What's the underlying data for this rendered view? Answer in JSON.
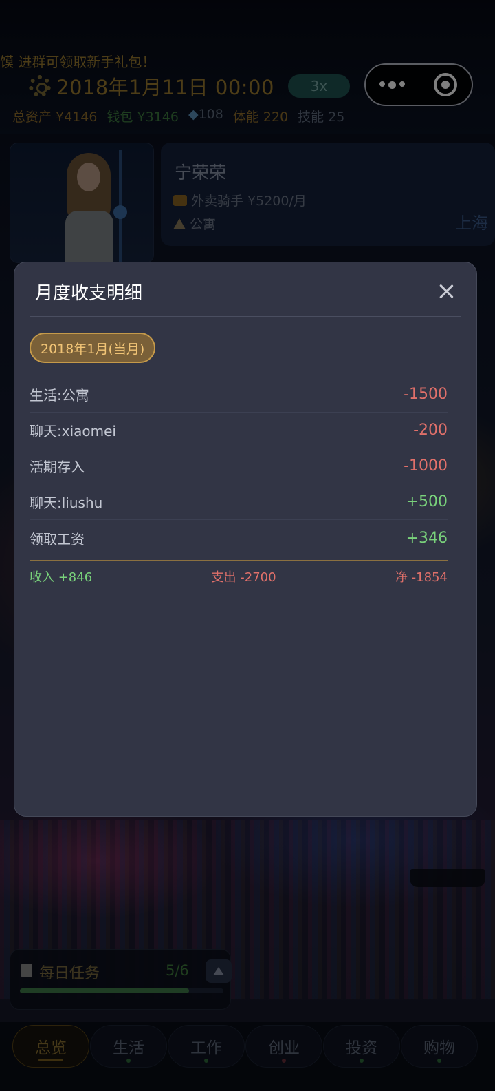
{
  "header": {
    "marquee": "馍    进群可领取新手礼包！",
    "date": "2018年1月11日 00:00",
    "speed": "3x",
    "stats": {
      "total_assets": "总资产 ¥4146",
      "wallet": "钱包 ¥3146",
      "diamonds": "108",
      "stamina": "体能 220",
      "skill": "技能 25"
    }
  },
  "profile": {
    "name": "宁荣荣",
    "job": "外卖骑手 ¥5200/月",
    "home": "公寓",
    "side_text": "上海"
  },
  "modal": {
    "title": "月度收支明细",
    "month": "2018年1月(当月)",
    "items": [
      {
        "label": "生活:公寓",
        "amount": "-1500",
        "kind": "neg"
      },
      {
        "label": "聊天:xiaomei",
        "amount": "-200",
        "kind": "neg"
      },
      {
        "label": "活期存入",
        "amount": "-1000",
        "kind": "neg"
      },
      {
        "label": "聊天:liushu",
        "amount": "+500",
        "kind": "pos"
      },
      {
        "label": "领取工资",
        "amount": "+346",
        "kind": "pos"
      }
    ],
    "totals": {
      "income": "收入 +846",
      "expense": "支出 -2700",
      "net": "净 -1854"
    }
  },
  "tasks": {
    "title": "每日任务",
    "count": "5/6",
    "progress": 0.83
  },
  "tabs": [
    {
      "label": "总览",
      "active": true
    },
    {
      "label": "生活",
      "active": false,
      "dot": "#2f6a3a"
    },
    {
      "label": "工作",
      "active": false,
      "dot": "#2f6a3a"
    },
    {
      "label": "创业",
      "active": false,
      "dot": "#6a2f3a"
    },
    {
      "label": "投资",
      "active": false,
      "dot": "#2f6a3a"
    },
    {
      "label": "购物",
      "active": false,
      "dot": "#2f6a3a"
    }
  ],
  "colors": {
    "accent_gold": "#f1c476",
    "negative": "#e0706a",
    "positive": "#79d27b"
  }
}
